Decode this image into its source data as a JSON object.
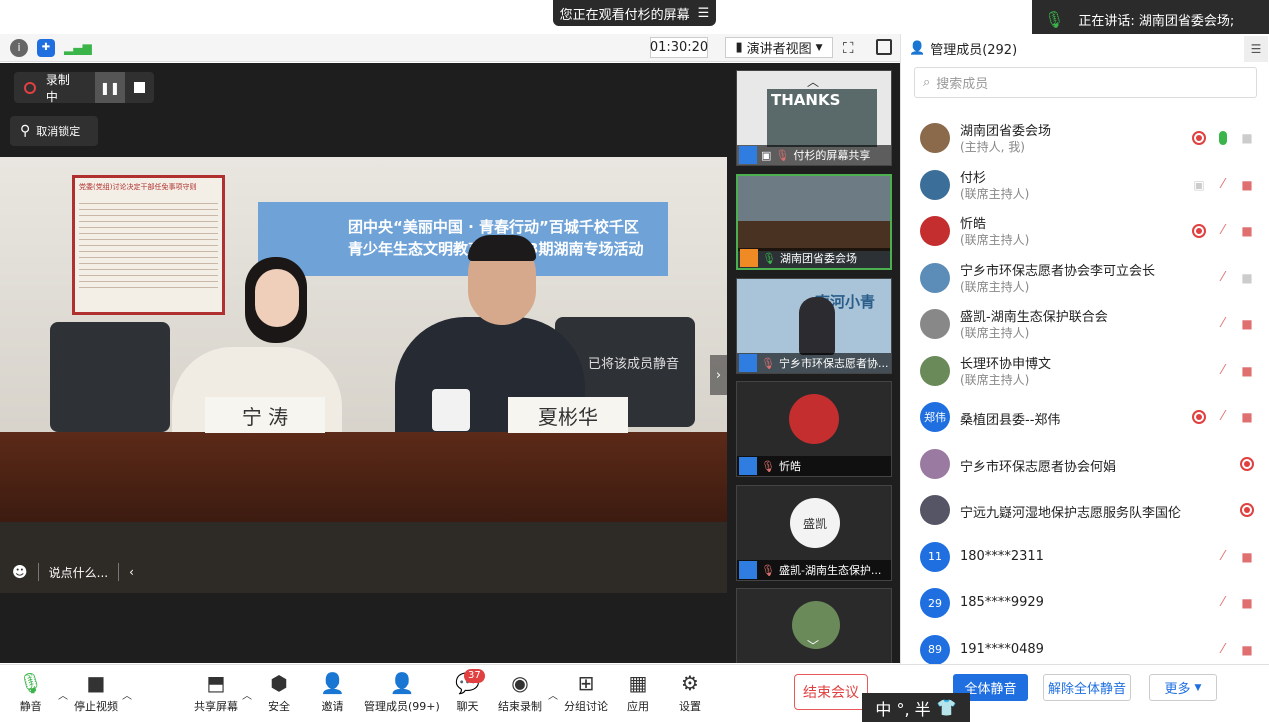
{
  "banner": {
    "watching": "您正在观看付杉的屏幕",
    "menu_icon": "list-icon"
  },
  "speaking": {
    "text": "正在讲话: 湖南团省委会场;"
  },
  "topbar": {
    "timer": "01:30:20",
    "view_mode": "演讲者视图"
  },
  "stage": {
    "recording_label": "录制中",
    "unlock_label": "取消锁定",
    "muted_hint": "已将该成员静音",
    "chat_placeholder": "说点什么...",
    "banner_line1": "团中央“美丽中国 · 青春行动”百城千校千区",
    "banner_line2": "青少年生态文明教育…讲第3期湖南专场活动",
    "board_title": "党委(党组)讨论决定干部任免事项守则",
    "nameplate_left": "宁 涛",
    "nameplate_right": "夏彬华"
  },
  "thumbnails": [
    {
      "label": "付杉的屏幕共享",
      "preview_text": "THANKS"
    },
    {
      "label": "湖南团省委会场"
    },
    {
      "label": "宁乡市环保志愿者协...",
      "preview_text": "南河小青"
    },
    {
      "label": "忻皓"
    },
    {
      "label": "盛凯-湖南生态保护...",
      "preview_text": "盛凯"
    },
    {
      "label": "…"
    }
  ],
  "sidebar": {
    "title": "管理成员(292)",
    "search_placeholder": "搜索成员",
    "members": [
      {
        "name": "湖南团省委会场",
        "role": "(主持人, 我)",
        "avatar": "",
        "color": "#8a6a4a"
      },
      {
        "name": "付杉",
        "role": "(联席主持人)",
        "avatar": "",
        "color": "#3c6e9a"
      },
      {
        "name": "忻皓",
        "role": "(联席主持人)",
        "avatar": "",
        "color": "#c42e2e"
      },
      {
        "name": "宁乡市环保志愿者协会李可立会长",
        "role": "(联席主持人)",
        "avatar": "",
        "color": "#5b8db8"
      },
      {
        "name": "盛凯-湖南生态保护联合会",
        "role": "(联席主持人)",
        "avatar": "",
        "color": "#888888"
      },
      {
        "name": "长理环协申博文",
        "role": "(联席主持人)",
        "avatar": "",
        "color": "#6b8a5a"
      },
      {
        "name": "桑植团县委--郑伟",
        "role": "",
        "avatar": "郑伟",
        "color": "#1f6fe0"
      },
      {
        "name": "宁乡市环保志愿者协会何娟",
        "role": "",
        "avatar": "",
        "color": "#9a7aa0"
      },
      {
        "name": "宁远九嶷河湿地保护志愿服务队李国伦",
        "role": "",
        "avatar": "",
        "color": "#555566"
      },
      {
        "name": "180****2311",
        "role": "",
        "avatar": "11",
        "color": "#1f6fe0"
      },
      {
        "name": "185****9929",
        "role": "",
        "avatar": "29",
        "color": "#1f6fe0"
      },
      {
        "name": "191****0489",
        "role": "",
        "avatar": "89",
        "color": "#1f6fe0"
      }
    ],
    "mute_all": "全体静音",
    "unmute_all": "解除全体静音",
    "more": "更多"
  },
  "toolbar": {
    "mute": "静音",
    "stop_video": "停止视频",
    "share_screen": "共享屏幕",
    "security": "安全",
    "invite": "邀请",
    "manage_members": "管理成员(99+)",
    "chat": "聊天",
    "chat_badge": "37",
    "end_recording": "结束录制",
    "breakout": "分组讨论",
    "apps": "应用",
    "settings": "设置",
    "end_meeting": "结束会议"
  },
  "ime": {
    "text": "中 °, 半"
  },
  "colors": {
    "accent_blue": "#1f6fe0",
    "end_red": "#e04040",
    "active_green": "#4caf50"
  }
}
